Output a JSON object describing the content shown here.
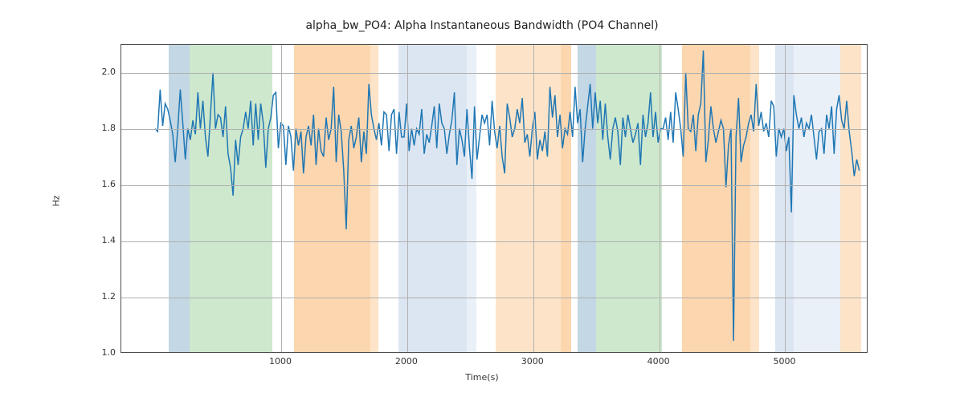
{
  "chart_data": {
    "type": "line",
    "title": "alpha_bw_PO4: Alpha Instantaneous Bandwidth (PO4 Channel)",
    "xlabel": "Time(s)",
    "ylabel": "Hz",
    "xlim": [
      -269,
      5660
    ],
    "ylim": [
      1.0,
      2.1
    ],
    "xticks": [
      1000,
      2000,
      3000,
      4000,
      5000
    ],
    "yticks": [
      1.0,
      1.2,
      1.4,
      1.6,
      1.8,
      2.0
    ],
    "bands": [
      {
        "x0": 110,
        "x1": 270,
        "color": "#c3d7e4"
      },
      {
        "x0": 270,
        "x1": 930,
        "color": "#cee8ce"
      },
      {
        "x0": 1100,
        "x1": 1710,
        "color": "#fcd6ae"
      },
      {
        "x0": 1710,
        "x1": 1770,
        "color": "#fde4c8"
      },
      {
        "x0": 1930,
        "x1": 2470,
        "color": "#dce6f2"
      },
      {
        "x0": 2470,
        "x1": 2550,
        "color": "#eaf0f8"
      },
      {
        "x0": 2700,
        "x1": 3220,
        "color": "#fde4c8"
      },
      {
        "x0": 3220,
        "x1": 3300,
        "color": "#fcd6ae"
      },
      {
        "x0": 3350,
        "x1": 3500,
        "color": "#c3d7e4"
      },
      {
        "x0": 3500,
        "x1": 4020,
        "color": "#cee8ce"
      },
      {
        "x0": 4180,
        "x1": 4720,
        "color": "#fcd6ae"
      },
      {
        "x0": 4720,
        "x1": 4790,
        "color": "#fde4c8"
      },
      {
        "x0": 4920,
        "x1": 5070,
        "color": "#dce6f2"
      },
      {
        "x0": 5070,
        "x1": 5440,
        "color": "#eaf0f8"
      },
      {
        "x0": 5440,
        "x1": 5600,
        "color": "#fde4c8"
      }
    ],
    "x": [
      0,
      20,
      40,
      60,
      80,
      100,
      120,
      140,
      160,
      180,
      200,
      220,
      240,
      260,
      280,
      300,
      320,
      340,
      360,
      380,
      400,
      420,
      440,
      460,
      480,
      500,
      520,
      540,
      560,
      580,
      600,
      620,
      640,
      660,
      680,
      700,
      720,
      740,
      760,
      780,
      800,
      820,
      840,
      860,
      880,
      900,
      920,
      940,
      960,
      980,
      1000,
      1020,
      1040,
      1060,
      1080,
      1100,
      1120,
      1140,
      1160,
      1180,
      1200,
      1220,
      1240,
      1260,
      1280,
      1300,
      1320,
      1340,
      1360,
      1380,
      1400,
      1420,
      1440,
      1460,
      1480,
      1500,
      1520,
      1540,
      1560,
      1580,
      1600,
      1620,
      1640,
      1660,
      1680,
      1700,
      1720,
      1740,
      1760,
      1780,
      1800,
      1820,
      1840,
      1860,
      1880,
      1900,
      1920,
      1940,
      1960,
      1980,
      2000,
      2020,
      2040,
      2060,
      2080,
      2100,
      2120,
      2140,
      2160,
      2180,
      2200,
      2220,
      2240,
      2260,
      2280,
      2300,
      2320,
      2340,
      2360,
      2380,
      2400,
      2420,
      2440,
      2460,
      2480,
      2500,
      2520,
      2540,
      2560,
      2580,
      2600,
      2620,
      2640,
      2660,
      2680,
      2700,
      2720,
      2740,
      2760,
      2780,
      2800,
      2820,
      2840,
      2860,
      2880,
      2900,
      2920,
      2940,
      2960,
      2980,
      3000,
      3020,
      3040,
      3060,
      3080,
      3100,
      3120,
      3140,
      3160,
      3180,
      3200,
      3220,
      3240,
      3260,
      3280,
      3300,
      3320,
      3340,
      3360,
      3380,
      3400,
      3420,
      3440,
      3460,
      3480,
      3500,
      3520,
      3540,
      3560,
      3580,
      3600,
      3620,
      3640,
      3660,
      3680,
      3700,
      3720,
      3740,
      3760,
      3780,
      3800,
      3820,
      3840,
      3860,
      3880,
      3900,
      3920,
      3940,
      3960,
      3980,
      4000,
      4020,
      4040,
      4060,
      4080,
      4100,
      4120,
      4140,
      4160,
      4180,
      4200,
      4220,
      4240,
      4260,
      4280,
      4300,
      4320,
      4340,
      4360,
      4380,
      4400,
      4420,
      4440,
      4460,
      4480,
      4500,
      4520,
      4540,
      4560,
      4580,
      4600,
      4620,
      4640,
      4660,
      4680,
      4700,
      4720,
      4740,
      4760,
      4780,
      4800,
      4820,
      4840,
      4860,
      4880,
      4900,
      4920,
      4940,
      4960,
      4980,
      5000,
      5020,
      5040,
      5060,
      5080,
      5100,
      5120,
      5140,
      5160,
      5180,
      5200,
      5220,
      5240,
      5260,
      5280,
      5300,
      5320,
      5340,
      5360,
      5380,
      5400,
      5420,
      5440,
      5460,
      5480,
      5500,
      5520,
      5540,
      5560,
      5580,
      5600
    ],
    "y": [
      1.8,
      1.79,
      1.94,
      1.81,
      1.89,
      1.87,
      1.83,
      1.78,
      1.68,
      1.8,
      1.94,
      1.82,
      1.69,
      1.8,
      1.76,
      1.83,
      1.78,
      1.93,
      1.8,
      1.9,
      1.77,
      1.7,
      1.85,
      2.0,
      1.8,
      1.85,
      1.84,
      1.77,
      1.88,
      1.71,
      1.66,
      1.56,
      1.76,
      1.67,
      1.77,
      1.8,
      1.86,
      1.8,
      1.9,
      1.74,
      1.89,
      1.76,
      1.89,
      1.82,
      1.66,
      1.8,
      1.84,
      1.92,
      1.93,
      1.73,
      1.82,
      1.81,
      1.67,
      1.81,
      1.77,
      1.65,
      1.8,
      1.74,
      1.79,
      1.64,
      1.77,
      1.81,
      1.74,
      1.85,
      1.67,
      1.8,
      1.72,
      1.7,
      1.84,
      1.76,
      1.8,
      1.95,
      1.68,
      1.85,
      1.79,
      1.65,
      1.44,
      1.76,
      1.81,
      1.73,
      1.77,
      1.84,
      1.68,
      1.79,
      1.71,
      1.96,
      1.85,
      1.8,
      1.76,
      1.82,
      1.74,
      1.86,
      1.85,
      1.72,
      1.85,
      1.87,
      1.71,
      1.86,
      1.77,
      1.77,
      1.89,
      1.72,
      1.8,
      1.74,
      1.8,
      1.78,
      1.87,
      1.71,
      1.78,
      1.75,
      1.81,
      1.88,
      1.73,
      1.89,
      1.82,
      1.8,
      1.71,
      1.78,
      1.83,
      1.93,
      1.67,
      1.8,
      1.76,
      1.7,
      1.87,
      1.73,
      1.62,
      1.88,
      1.69,
      1.77,
      1.85,
      1.82,
      1.85,
      1.74,
      1.9,
      1.79,
      1.73,
      1.81,
      1.7,
      1.64,
      1.89,
      1.84,
      1.77,
      1.8,
      1.87,
      1.82,
      1.91,
      1.75,
      1.78,
      1.7,
      1.8,
      1.86,
      1.69,
      1.76,
      1.72,
      1.79,
      1.7,
      1.95,
      1.84,
      1.92,
      1.77,
      1.85,
      1.73,
      1.8,
      1.78,
      1.86,
      1.77,
      1.95,
      1.82,
      1.87,
      1.68,
      1.8,
      1.88,
      1.96,
      1.8,
      1.93,
      1.82,
      1.9,
      1.76,
      1.89,
      1.77,
      1.69,
      1.8,
      1.84,
      1.79,
      1.67,
      1.84,
      1.77,
      1.85,
      1.8,
      1.75,
      1.78,
      1.82,
      1.67,
      1.85,
      1.77,
      1.82,
      1.93,
      1.77,
      1.86,
      1.75,
      1.8,
      1.8,
      1.84,
      1.76,
      1.86,
      1.75,
      1.93,
      1.87,
      1.8,
      1.7,
      2.0,
      1.8,
      1.79,
      1.85,
      1.72,
      1.85,
      1.89,
      2.08,
      1.68,
      1.76,
      1.88,
      1.8,
      1.75,
      1.79,
      1.83,
      1.8,
      1.59,
      1.74,
      1.8,
      1.04,
      1.77,
      1.91,
      1.68,
      1.74,
      1.77,
      1.82,
      1.85,
      1.79,
      1.96,
      1.81,
      1.86,
      1.79,
      1.82,
      1.77,
      1.9,
      1.88,
      1.7,
      1.8,
      1.77,
      1.8,
      1.72,
      1.77,
      1.5,
      1.92,
      1.85,
      1.8,
      1.84,
      1.77,
      1.82,
      1.8,
      1.85,
      1.77,
      1.69,
      1.79,
      1.8,
      1.71,
      1.85,
      1.8,
      1.88,
      1.71,
      1.87,
      1.92,
      1.83,
      1.8,
      1.9,
      1.79,
      1.72,
      1.63,
      1.69,
      1.65
    ]
  }
}
